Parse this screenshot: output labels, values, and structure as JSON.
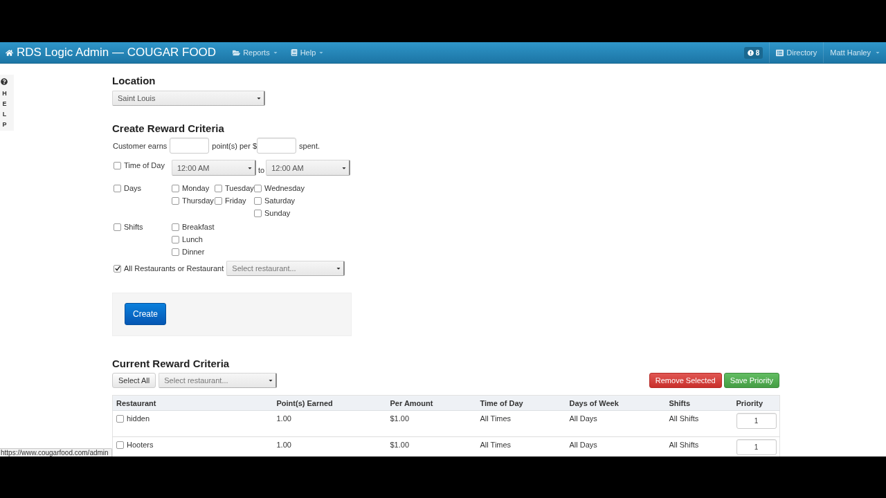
{
  "navbar": {
    "brand": "RDS Logic Admin — COUGAR FOOD",
    "menus": [
      {
        "label": "Reports"
      },
      {
        "label": "Help"
      }
    ],
    "alerts": {
      "count": "8"
    },
    "links": [
      {
        "label": "Directory"
      }
    ],
    "user": {
      "name": "Matt Hanley"
    }
  },
  "help_tab": {
    "label": "HELP"
  },
  "location": {
    "heading": "Location",
    "select": {
      "value": "Saint Louis"
    }
  },
  "create_form": {
    "heading": "Create Reward Criteria",
    "earn_row": {
      "prefix": "Customer earns",
      "middle": "point(s) per $",
      "suffix": "spent."
    },
    "time_of_day": {
      "label": "Time of Day",
      "checked": false,
      "from": "12:00 AM",
      "separator": "to",
      "to": "12:00 AM"
    },
    "days": {
      "label": "Days",
      "checked": false,
      "options": [
        {
          "label": "Monday",
          "checked": false
        },
        {
          "label": "Tuesday",
          "checked": false
        },
        {
          "label": "Wednesday",
          "checked": false
        },
        {
          "label": "Thursday",
          "checked": false
        },
        {
          "label": "Friday",
          "checked": false
        },
        {
          "label": "Saturday",
          "checked": false
        },
        {
          "label": "Sunday",
          "checked": false
        }
      ]
    },
    "shifts": {
      "label": "Shifts",
      "checked": false,
      "options": [
        {
          "label": "Breakfast",
          "checked": false
        },
        {
          "label": "Lunch",
          "checked": false
        },
        {
          "label": "Dinner",
          "checked": false
        }
      ]
    },
    "restaurant": {
      "label": "All Restaurants or Restaurant",
      "checked": true,
      "select": {
        "placeholder": "Select restaurant..."
      }
    },
    "create_button": "Create"
  },
  "current_criteria": {
    "heading": "Current Reward Criteria",
    "select_all_button": "Select All",
    "filter": {
      "placeholder": "Select restaurant..."
    },
    "remove_button": "Remove Selected",
    "save_button": "Save Priority",
    "table": {
      "columns": [
        "Restaurant",
        "Point(s) Earned",
        "Per Amount",
        "Time of Day",
        "Days of Week",
        "Shifts",
        "Priority"
      ],
      "rows": [
        {
          "checked": false,
          "restaurant": "hidden",
          "points": "1.00",
          "per_amount": "$1.00",
          "time_of_day": "All Times",
          "days": "All Days",
          "shifts": "All Shifts",
          "priority": "1"
        },
        {
          "checked": false,
          "restaurant": "Hooters",
          "points": "1.00",
          "per_amount": "$1.00",
          "time_of_day": "All Times",
          "days": "All Days",
          "shifts": "All Shifts",
          "priority": "1"
        }
      ]
    }
  },
  "status_bar": {
    "url": "https://www.cougarfood.com/admin"
  }
}
